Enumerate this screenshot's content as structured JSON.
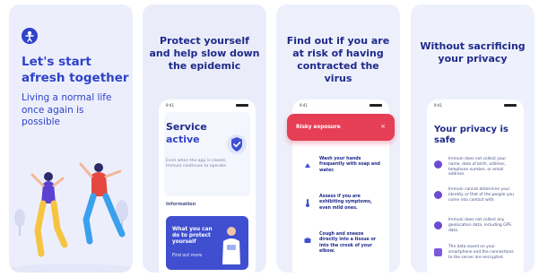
{
  "panel1": {
    "title_line1": "Let's start",
    "title_line2": "afresh together",
    "subtitle": "Living a normal life once again is possible"
  },
  "panel2": {
    "heading": "Protect yourself and help slow down the epidemic",
    "time": "9:41",
    "service_title": "Service",
    "service_status": "active",
    "service_desc": "Even when the app is closed, Immuni continues to operate.",
    "info_label": "Information",
    "info_card_text": "What you can do to protect yourself",
    "info_card_link": "Find out more"
  },
  "panel3": {
    "heading": "Find out if you are at risk of having contracted the virus",
    "time": "9:41",
    "risk_title": "Risky exposure",
    "risk_close": "×",
    "tips": [
      {
        "text": "Wash your hands frequently with soap and water.",
        "icon": "hand-wash-icon"
      },
      {
        "text": "Assess if you are exhibiting symptoms, even mild ones.",
        "icon": "thermometer-icon"
      },
      {
        "text": "Cough and sneeze directly into a tissue or into the crook of your elbow.",
        "icon": "tissue-icon"
      }
    ]
  },
  "panel4": {
    "heading": "Without sacrificing your privacy",
    "time": "9:41",
    "title": "Your privacy is safe",
    "items": [
      {
        "text": "Immuni does not collect your name, date of birth, address, telephone number, or email address."
      },
      {
        "text": "Immuni cannot determine your identity or that of the people you come into contact with."
      },
      {
        "text": "Immuni does not collect any geolocation data, including GPS data."
      },
      {
        "text": "The data saved on your smartphone and the connections to the server are encrypted."
      }
    ]
  },
  "colors": {
    "brand_blue": "#2f42c9",
    "dark_navy": "#1f2a8a",
    "risk_red": "#e53e55",
    "privacy_purple": "#6b4bd3",
    "panel_bg": "#eceffb"
  }
}
